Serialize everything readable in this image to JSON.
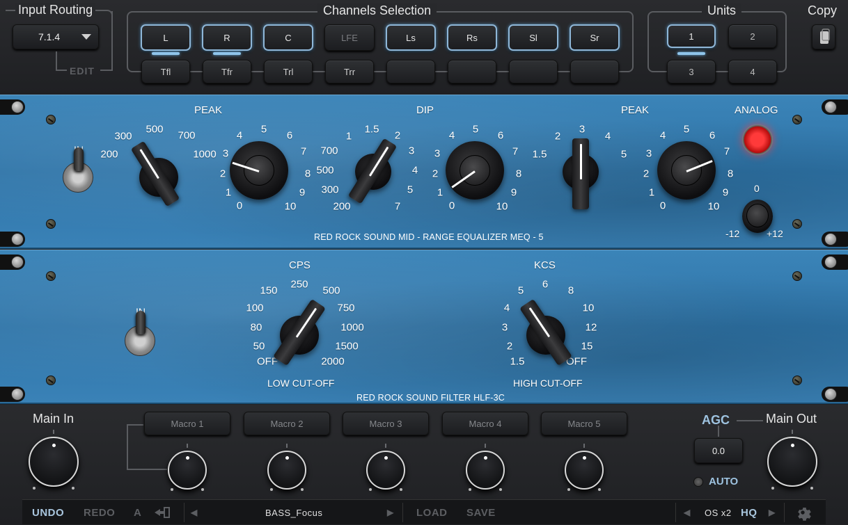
{
  "input_routing": {
    "title": "Input Routing",
    "format_value": "7.1.4",
    "edit_label": "EDIT"
  },
  "channels": {
    "title": "Channels Selection",
    "row1": [
      {
        "label": "L",
        "on": true,
        "ind": true
      },
      {
        "label": "R",
        "on": true,
        "ind": true
      },
      {
        "label": "C",
        "on": true,
        "ind": false
      },
      {
        "label": "LFE",
        "on": false,
        "ind": false
      },
      {
        "label": "Ls",
        "on": true,
        "ind": false
      },
      {
        "label": "Rs",
        "on": true,
        "ind": false
      },
      {
        "label": "Sl",
        "on": true,
        "ind": false
      },
      {
        "label": "Sr",
        "on": true,
        "ind": false
      }
    ],
    "row2": [
      {
        "label": "Tfl"
      },
      {
        "label": "Tfr"
      },
      {
        "label": "Trl"
      },
      {
        "label": "Trr"
      },
      {
        "label": ""
      },
      {
        "label": ""
      },
      {
        "label": ""
      },
      {
        "label": ""
      }
    ]
  },
  "units": {
    "title": "Units",
    "items": [
      "1",
      "2",
      "3",
      "4"
    ],
    "active": "1"
  },
  "copy": {
    "title": "Copy"
  },
  "meq": {
    "in_label": "IN",
    "peak1": {
      "title": "PEAK",
      "freqs": [
        "200",
        "300",
        "500",
        "700",
        "1000"
      ],
      "boost": [
        "0",
        "1",
        "2",
        "3",
        "4",
        "5",
        "6",
        "7",
        "8",
        "9",
        "10"
      ]
    },
    "dip": {
      "title": "DIP",
      "freqs": [
        "200",
        "300",
        "500",
        "700",
        "1",
        "1.5",
        "2",
        "3",
        "4",
        "5",
        "7"
      ],
      "amount": [
        "0",
        "1",
        "2",
        "3",
        "4",
        "5",
        "6",
        "7",
        "8",
        "9",
        "10"
      ]
    },
    "peak2": {
      "title": "PEAK",
      "freqs": [
        "1.5",
        "2",
        "3",
        "4",
        "5"
      ],
      "boost": [
        "0",
        "1",
        "2",
        "3",
        "4",
        "5",
        "6",
        "7",
        "8",
        "9",
        "10"
      ]
    },
    "analog": {
      "title": "ANALOG",
      "gain_min": "-12",
      "gain_mid": "0",
      "gain_max": "+12"
    },
    "brand": "RED ROCK SOUND  MID - RANGE EQUALIZER   MEQ - 5"
  },
  "hlf": {
    "in_label": "IN",
    "cps": {
      "title": "CPS",
      "values": [
        "OFF",
        "50",
        "80",
        "100",
        "150",
        "250",
        "500",
        "750",
        "1000",
        "1500",
        "2000"
      ],
      "caption": "LOW CUT-OFF"
    },
    "kcs": {
      "title": "KCS",
      "values": [
        "1.5",
        "2",
        "3",
        "4",
        "5",
        "6",
        "8",
        "10",
        "12",
        "15",
        "OFF"
      ],
      "caption": "HIGH CUT-OFF"
    },
    "brand": "RED ROCK SOUND  FILTER   HLF-3C"
  },
  "bottom": {
    "main_in": "Main In",
    "macros": [
      "Macro 1",
      "Macro 2",
      "Macro 3",
      "Macro 4",
      "Macro 5"
    ],
    "agc": "AGC",
    "agc_value": "0.0",
    "auto": "AUTO",
    "main_out": "Main Out"
  },
  "statusbar": {
    "undo": "UNDO",
    "redo": "REDO",
    "ab": "A",
    "preset": "BASS_Focus",
    "load": "LOAD",
    "save": "SAVE",
    "os": "OS x2",
    "hq": "HQ"
  }
}
